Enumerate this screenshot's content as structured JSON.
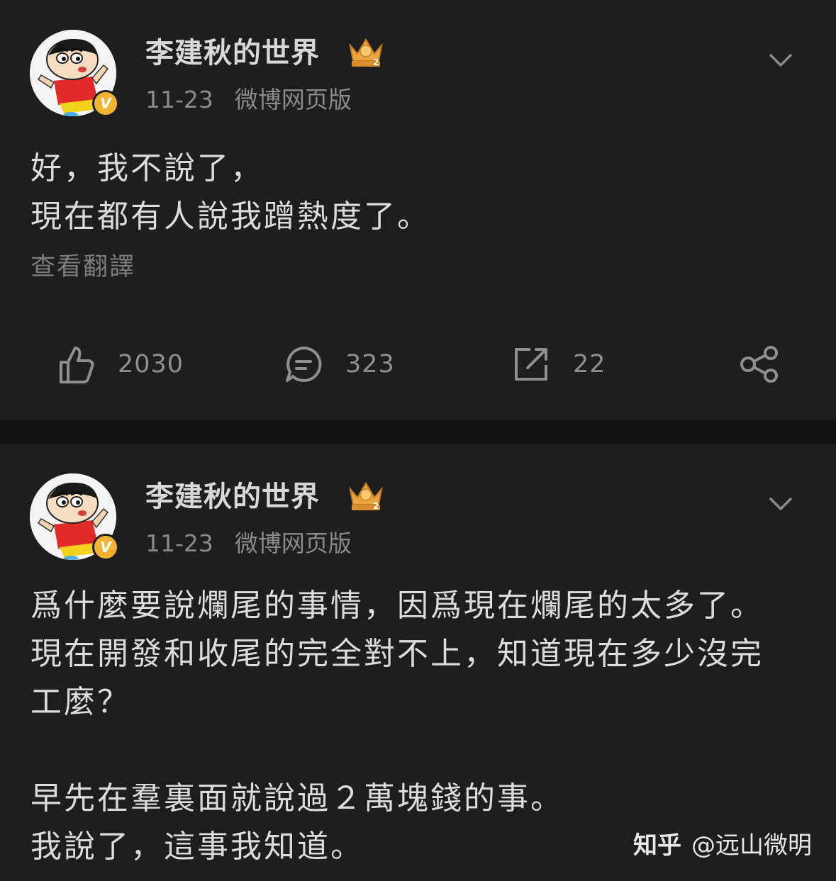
{
  "posts": [
    {
      "username": "李建秋的世界",
      "date": "11-23",
      "source": "微博网页版",
      "verified_badge": "V",
      "level_badge": "2",
      "content_lines": [
        "好，我不說了，",
        "現在都有人說我蹭熱度了。"
      ],
      "translate_label": "查看翻譯",
      "actions": {
        "like_count": "2030",
        "comment_count": "323",
        "repost_count": "22"
      }
    },
    {
      "username": "李建秋的世界",
      "date": "11-23",
      "source": "微博网页版",
      "verified_badge": "V",
      "level_badge": "2",
      "content_lines": [
        "爲什麼要說爛尾的事情，因爲現在爛尾的太多了。",
        "現在開發和收尾的完全對不上，知道現在多少沒完",
        "工麼？",
        "",
        "早先在羣裏面就說過２萬塊錢的事。",
        "我說了，這事我知道。"
      ]
    }
  ],
  "watermark": {
    "brand": "知乎",
    "handle": "@远山微明"
  },
  "colors": {
    "background": "#1e1e1e",
    "divider": "#121212",
    "verified": "#f0b430",
    "crown": "#e8a640"
  },
  "icons": [
    "thumbs-up-icon",
    "comment-icon",
    "repost-icon",
    "share-icon",
    "chevron-down-icon",
    "crown-icon",
    "verified-icon"
  ]
}
